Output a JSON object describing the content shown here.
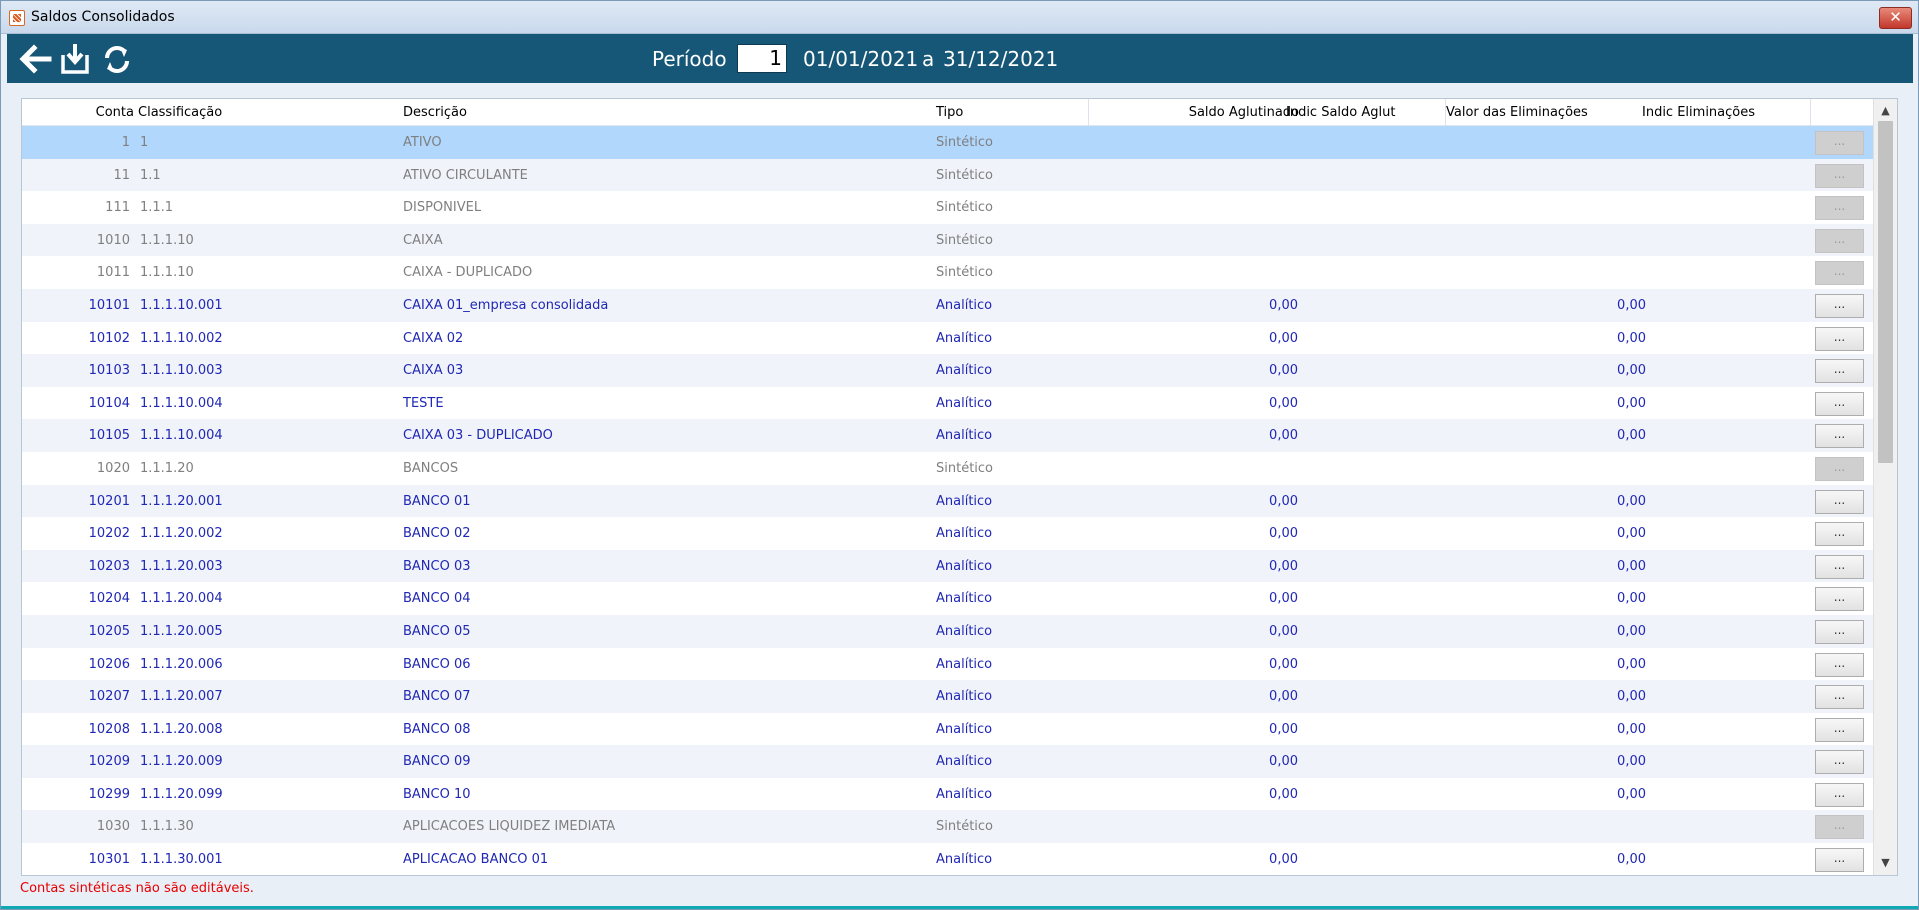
{
  "window": {
    "title": "Saldos Consolidados",
    "close_label": "✕"
  },
  "toolbar": {
    "back_icon": "arrow-left-icon",
    "download_icon": "download-icon",
    "refresh_icon": "refresh-icon",
    "periodo_label": "Período",
    "periodo_value": "1",
    "date_start": "01/01/2021",
    "date_sep": "a",
    "date_end": "31/12/2021"
  },
  "grid": {
    "columns": {
      "conta": "Conta",
      "classificacao": "Classificação",
      "descricao": "Descrição",
      "tipo": "Tipo",
      "saldo": "Saldo Aglutinado",
      "indic_saldo": "Indic Saldo Aglut",
      "valor_elim": "Valor das Eliminações",
      "indic_elim": "Indic Eliminações"
    },
    "button_label": "...",
    "rows": [
      {
        "conta": "1",
        "classificacao": "1",
        "descricao": "ATIVO",
        "tipo": "Sintético",
        "saldo": "",
        "elim": ""
      },
      {
        "conta": "11",
        "classificacao": "1.1",
        "descricao": "ATIVO CIRCULANTE",
        "tipo": "Sintético",
        "saldo": "",
        "elim": ""
      },
      {
        "conta": "111",
        "classificacao": "1.1.1",
        "descricao": "DISPONIVEL",
        "tipo": "Sintético",
        "saldo": "",
        "elim": ""
      },
      {
        "conta": "1010",
        "classificacao": "1.1.1.10",
        "descricao": "CAIXA",
        "tipo": "Sintético",
        "saldo": "",
        "elim": ""
      },
      {
        "conta": "1011",
        "classificacao": "1.1.1.10",
        "descricao": "CAIXA - DUPLICADO",
        "tipo": "Sintético",
        "saldo": "",
        "elim": ""
      },
      {
        "conta": "10101",
        "classificacao": "1.1.1.10.001",
        "descricao": "CAIXA 01_empresa consolidada",
        "tipo": "Analítico",
        "saldo": "0,00",
        "elim": "0,00"
      },
      {
        "conta": "10102",
        "classificacao": "1.1.1.10.002",
        "descricao": "CAIXA 02",
        "tipo": "Analítico",
        "saldo": "0,00",
        "elim": "0,00"
      },
      {
        "conta": "10103",
        "classificacao": "1.1.1.10.003",
        "descricao": "CAIXA 03",
        "tipo": "Analítico",
        "saldo": "0,00",
        "elim": "0,00"
      },
      {
        "conta": "10104",
        "classificacao": "1.1.1.10.004",
        "descricao": "TESTE",
        "tipo": "Analítico",
        "saldo": "0,00",
        "elim": "0,00"
      },
      {
        "conta": "10105",
        "classificacao": "1.1.1.10.004",
        "descricao": "CAIXA 03 - DUPLICADO",
        "tipo": "Analítico",
        "saldo": "0,00",
        "elim": "0,00"
      },
      {
        "conta": "1020",
        "classificacao": "1.1.1.20",
        "descricao": "BANCOS",
        "tipo": "Sintético",
        "saldo": "",
        "elim": ""
      },
      {
        "conta": "10201",
        "classificacao": "1.1.1.20.001",
        "descricao": "BANCO 01",
        "tipo": "Analítico",
        "saldo": "0,00",
        "elim": "0,00"
      },
      {
        "conta": "10202",
        "classificacao": "1.1.1.20.002",
        "descricao": "BANCO 02",
        "tipo": "Analítico",
        "saldo": "0,00",
        "elim": "0,00"
      },
      {
        "conta": "10203",
        "classificacao": "1.1.1.20.003",
        "descricao": "BANCO 03",
        "tipo": "Analítico",
        "saldo": "0,00",
        "elim": "0,00"
      },
      {
        "conta": "10204",
        "classificacao": "1.1.1.20.004",
        "descricao": "BANCO 04",
        "tipo": "Analítico",
        "saldo": "0,00",
        "elim": "0,00"
      },
      {
        "conta": "10205",
        "classificacao": "1.1.1.20.005",
        "descricao": "BANCO 05",
        "tipo": "Analítico",
        "saldo": "0,00",
        "elim": "0,00"
      },
      {
        "conta": "10206",
        "classificacao": "1.1.1.20.006",
        "descricao": "BANCO 06",
        "tipo": "Analítico",
        "saldo": "0,00",
        "elim": "0,00"
      },
      {
        "conta": "10207",
        "classificacao": "1.1.1.20.007",
        "descricao": "BANCO 07",
        "tipo": "Analítico",
        "saldo": "0,00",
        "elim": "0,00"
      },
      {
        "conta": "10208",
        "classificacao": "1.1.1.20.008",
        "descricao": "BANCO 08",
        "tipo": "Analítico",
        "saldo": "0,00",
        "elim": "0,00"
      },
      {
        "conta": "10209",
        "classificacao": "1.1.1.20.009",
        "descricao": "BANCO 09",
        "tipo": "Analítico",
        "saldo": "0,00",
        "elim": "0,00"
      },
      {
        "conta": "10299",
        "classificacao": "1.1.1.20.099",
        "descricao": "BANCO 10",
        "tipo": "Analítico",
        "saldo": "0,00",
        "elim": "0,00"
      },
      {
        "conta": "1030",
        "classificacao": "1.1.1.30",
        "descricao": "APLICACOES LIQUIDEZ IMEDIATA",
        "tipo": "Sintético",
        "saldo": "",
        "elim": ""
      },
      {
        "conta": "10301",
        "classificacao": "1.1.1.30.001",
        "descricao": "APLICACAO BANCO 01",
        "tipo": "Analítico",
        "saldo": "0,00",
        "elim": "0,00"
      }
    ],
    "scroll_up_icon": "▲",
    "scroll_down_icon": "▼"
  },
  "status": {
    "message": "Contas sintéticas não são editáveis."
  },
  "colors": {
    "toolbar": "#165676",
    "selected_row": "#b1d7fd",
    "analitico_text": "#1f27b5",
    "sintetico_text": "#7f7f7f",
    "status_text": "#e60000"
  }
}
